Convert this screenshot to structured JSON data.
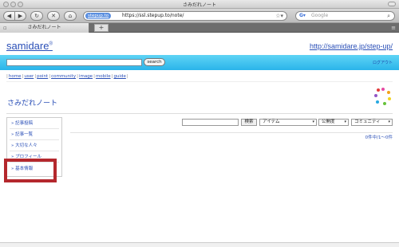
{
  "window": {
    "title": "さみだれノート"
  },
  "browser": {
    "back_icon": "back-arrow-icon",
    "forward_icon": "forward-arrow-icon",
    "reload_icon": "reload-icon",
    "stop_icon": "stop-icon",
    "home_icon": "home-icon",
    "site_badge": "stepup.to",
    "url": "https://ssl.stepup.to/note/",
    "search_placeholder": "Google",
    "tab_title": "さみだれノート",
    "new_tab": "+"
  },
  "header": {
    "logo": "samidare",
    "logo_mark": "®",
    "site_url": "http://samidare.jp/step-up/",
    "search_button": "search",
    "logout": "ログアウト"
  },
  "nav": {
    "links": [
      "home",
      "user",
      "point",
      "community",
      "image",
      "mobile",
      "guide"
    ]
  },
  "page": {
    "title": "さみだれノート"
  },
  "sidebar": {
    "items": [
      "記事投稿",
      "記事一覧",
      "大切な人々",
      "プロフィール",
      "基本情報"
    ]
  },
  "filter": {
    "search_button": "検索",
    "select_item": "アイテム",
    "select_public": "公開度",
    "select_community": "コミュニティ",
    "count": "0件中/1〜0件"
  },
  "colors": {
    "accent": "#2a4fb7",
    "band": "#2ab4ea",
    "highlight": "#b4282d"
  }
}
